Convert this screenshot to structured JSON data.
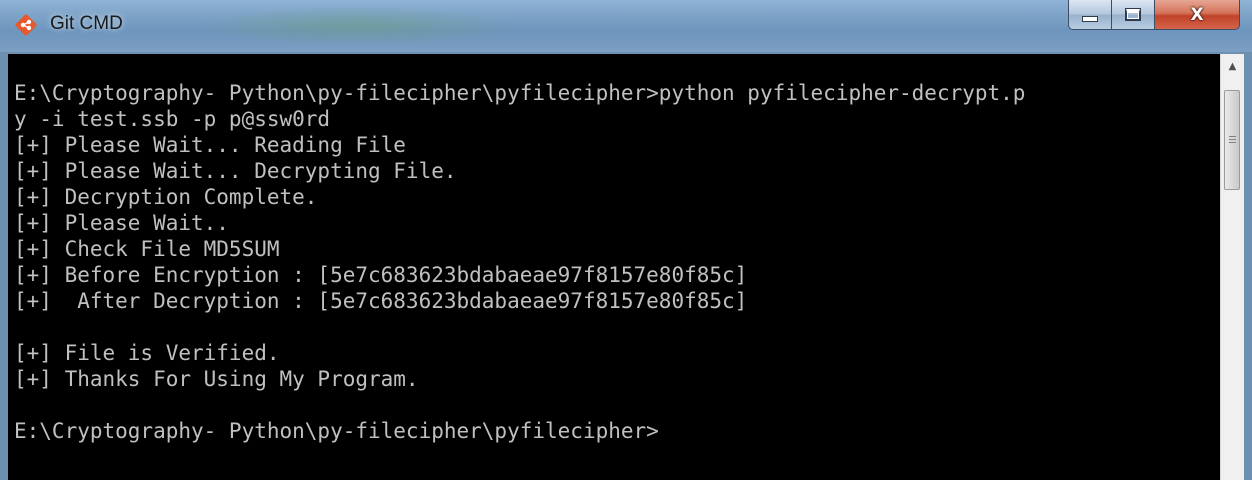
{
  "window": {
    "title": "Git CMD",
    "icon": "git-icon",
    "controls": {
      "minimize_icon": "minimize-icon",
      "maximize_icon": "maximize-icon",
      "close_glyph": "X"
    }
  },
  "console": {
    "lines": [
      "E:\\Cryptography- Python\\py-filecipher\\pyfilecipher>python pyfilecipher-decrypt.p",
      "y -i test.ssb -p p@ssw0rd",
      "[+] Please Wait... Reading File",
      "[+] Please Wait... Decrypting File.",
      "[+] Decryption Complete.",
      "[+] Please Wait..",
      "[+] Check File MD5SUM",
      "[+] Before Encryption : [5e7c683623bdabaeae97f8157e80f85c]",
      "[+]  After Decryption : [5e7c683623bdabaeae97f8157e80f85c]",
      "",
      "[+] File is Verified.",
      "[+] Thanks For Using My Program.",
      "",
      "E:\\Cryptography- Python\\py-filecipher\\pyfilecipher>"
    ]
  },
  "colors": {
    "console_background": "#000000",
    "console_text": "#c0c0c0",
    "titlebar": "#7aa1c6",
    "close_button": "#c0432a"
  }
}
